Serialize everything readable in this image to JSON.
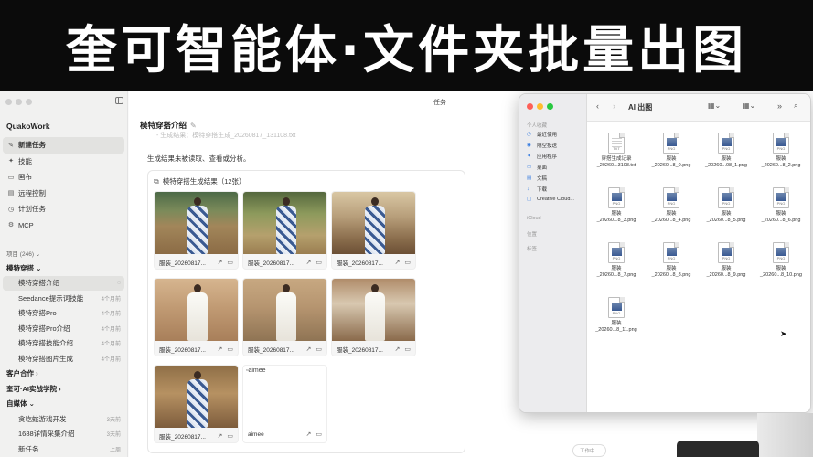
{
  "banner": {
    "title": "奎可智能体·文件夹批量出图"
  },
  "window": {
    "title": "任务"
  },
  "sidebar": {
    "app_name": "QuakoWork",
    "nav": [
      {
        "label": "新建任务",
        "icon": "new-task-icon",
        "glyph": "✎"
      },
      {
        "label": "技能",
        "icon": "skills-icon",
        "glyph": "✦"
      },
      {
        "label": "画布",
        "icon": "canvas-icon",
        "glyph": "▭"
      },
      {
        "label": "远程控制",
        "icon": "remote-icon",
        "glyph": "▤"
      },
      {
        "label": "计划任务",
        "icon": "schedule-icon",
        "glyph": "◷"
      },
      {
        "label": "MCP",
        "icon": "mcp-icon",
        "glyph": "⚙"
      }
    ],
    "projects_header": "项目 (246)",
    "groups": [
      {
        "label": "模特穿搭",
        "chevron": "⌄"
      },
      {
        "label": "客户合作",
        "chevron": "›"
      },
      {
        "label": "奎可·AI实战学院",
        "chevron": "›"
      },
      {
        "label": "自媒体",
        "chevron": "⌄"
      }
    ],
    "group1_items": [
      {
        "label": "模特穿搭介绍",
        "time": ""
      },
      {
        "label": "Seedance提示词技能",
        "time": "4个月前"
      },
      {
        "label": "模特穿搭Pro",
        "time": "4个月前"
      },
      {
        "label": "模特穿搭Pro介绍",
        "time": "4个月前"
      },
      {
        "label": "模特穿搭技能介绍",
        "time": "4个月前"
      },
      {
        "label": "模特穿搭图片生成",
        "time": "4个月前"
      }
    ],
    "group4_items": [
      {
        "label": "贪吃蛇游戏开发",
        "time": "3天前"
      },
      {
        "label": "1688详情采集介绍",
        "time": "3天前"
      },
      {
        "label": "新任务",
        "time": "上周"
      }
    ]
  },
  "main": {
    "task_title": "模特穿搭介绍",
    "top_line": "- 生成结果：模特穿搭生成_20260817_131108.txt",
    "result_msg": "生成结果未被读取、查看或分析。",
    "card_title": "模特穿搭生成结果（12张）",
    "thumb_caption": "服装_20260817...",
    "broken_alt": "aimee",
    "broken_caption": "aimee"
  },
  "finder": {
    "title": "AI 出图",
    "sections": {
      "favorites": "个人收藏",
      "icloud": "iCloud",
      "locations": "位置",
      "tags": "标签"
    },
    "favorites": [
      {
        "label": "最近使用",
        "glyph": "◷"
      },
      {
        "label": "隔空投送",
        "glyph": "◉"
      },
      {
        "label": "应用程序",
        "glyph": "✦"
      },
      {
        "label": "桌面",
        "glyph": "▭"
      },
      {
        "label": "文稿",
        "glyph": "▤"
      },
      {
        "label": "下载",
        "glyph": "↓"
      },
      {
        "label": "Creative Cloud...",
        "glyph": "▢"
      }
    ],
    "files": [
      {
        "ext": "TXT",
        "n1": "穿搭生成记录",
        "n2": "_20260...3108.txt"
      },
      {
        "ext": "PNG",
        "n1": "服装",
        "n2": "_20260...8_0.png"
      },
      {
        "ext": "PNG",
        "n1": "服装",
        "n2": "_20260...08_1.png"
      },
      {
        "ext": "PNG",
        "n1": "服装",
        "n2": "_20260...8_2.png"
      },
      {
        "ext": "PNG",
        "n1": "服装",
        "n2": "_20260...8_3.png"
      },
      {
        "ext": "PNG",
        "n1": "服装",
        "n2": "_20260...8_4.png"
      },
      {
        "ext": "PNG",
        "n1": "服装",
        "n2": "_20260...8_5.png"
      },
      {
        "ext": "PNG",
        "n1": "服装",
        "n2": "_20260...8_6.png"
      },
      {
        "ext": "PNG",
        "n1": "服装",
        "n2": "_20260...8_7.png"
      },
      {
        "ext": "PNG",
        "n1": "服装",
        "n2": "_20260...8_8.png"
      },
      {
        "ext": "PNG",
        "n1": "服装",
        "n2": "_20260...8_9.png"
      },
      {
        "ext": "PNG",
        "n1": "服装",
        "n2": "_20260...8_10.png"
      },
      {
        "ext": "PNG",
        "n1": "服装",
        "n2": "_20260...8_11.png"
      }
    ]
  },
  "status_pill": "工作中..."
}
